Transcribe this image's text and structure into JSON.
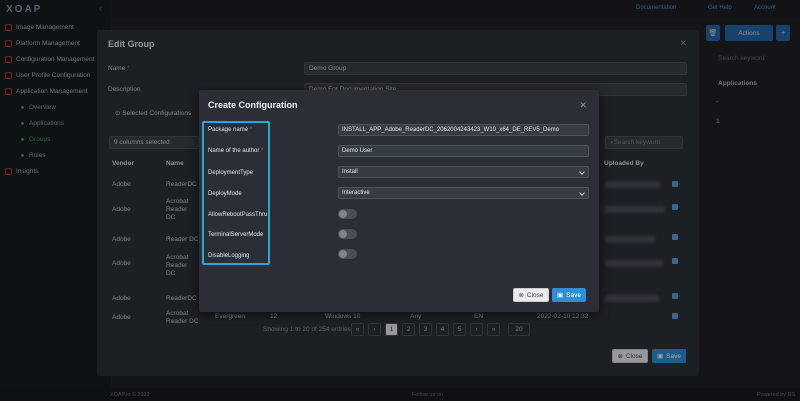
{
  "app": {
    "logo": "XOAP",
    "top_links": [
      "Documentation",
      "Get Help",
      "Account"
    ],
    "actions_label": "Actions",
    "search_placeholder": "Search keyword",
    "column_applications": "Applications",
    "app_rows": [
      "-",
      "1"
    ],
    "footer_left": "XOAP.io © 2022",
    "footer_center": "Follow us on",
    "footer_right": "Powered by RS"
  },
  "sidebar": {
    "items": [
      {
        "label": "Image Management"
      },
      {
        "label": "Platform Management"
      },
      {
        "label": "Configuration Management"
      },
      {
        "label": "User Profile Configuration"
      },
      {
        "label": "Application Management"
      }
    ],
    "subitems": [
      {
        "label": "Overview",
        "active": false
      },
      {
        "label": "Applications",
        "active": false
      },
      {
        "label": "Groups",
        "active": true
      },
      {
        "label": "Roles",
        "active": false
      }
    ],
    "insights": "Insights"
  },
  "edit_group": {
    "title": "Edit Group",
    "name_label": "Name",
    "name_value": "Demo Group",
    "description_label": "Description",
    "description_value": "Demo For Documentation Site",
    "tab_label": "Selected Configurations",
    "columns_select": "9 columns selected",
    "search_placeholder": "Search keyword",
    "headers": {
      "vendor": "Vendor",
      "name": "Name",
      "uploaded_by": "Uploaded By"
    },
    "rows": [
      {
        "vendor": "Adobe",
        "name": "ReaderDC"
      },
      {
        "vendor": "Adobe",
        "name": "Acrobat Reader DC"
      },
      {
        "vendor": "Adobe",
        "name": "Reader DC"
      },
      {
        "vendor": "Adobe",
        "name": "Acrobat Reader DC"
      },
      {
        "vendor": "Adobe",
        "name": "ReaderDC"
      },
      {
        "vendor": "Adobe",
        "name": "Acrobat Reader DC"
      }
    ],
    "partial_row": [
      "Evergreen",
      "12",
      "Windows 10",
      "Any",
      "EN",
      "2022-02-10 12:32"
    ],
    "showing": "Showing 1 to 20 of 254 entries",
    "pages": [
      "1",
      "2",
      "3",
      "4",
      "5"
    ],
    "page_size": "20",
    "close_label": "Close",
    "save_label": "Save"
  },
  "create_config": {
    "title": "Create Configuration",
    "fields": {
      "package_name": {
        "label": "Package name",
        "required": true,
        "value": "INSTALL_APP_Adobe_ReaderDC_2062004243423_W10_x64_DE_REV5_Demo"
      },
      "author": {
        "label": "Name of the author",
        "required": true,
        "value": "Demo User"
      },
      "deployment_type": {
        "label": "DeploymentType",
        "value": "Install"
      },
      "deploy_mode": {
        "label": "DeployMode",
        "value": "Interactive"
      },
      "allow_reboot": {
        "label": "AllowRebootPassThru",
        "value": false
      },
      "terminal_server": {
        "label": "TerminalServerMode",
        "value": false
      },
      "disable_logging": {
        "label": "DisableLogging",
        "value": false
      }
    },
    "close_label": "Close",
    "save_label": "Save",
    "highlight_color": "#2ea3dc"
  }
}
